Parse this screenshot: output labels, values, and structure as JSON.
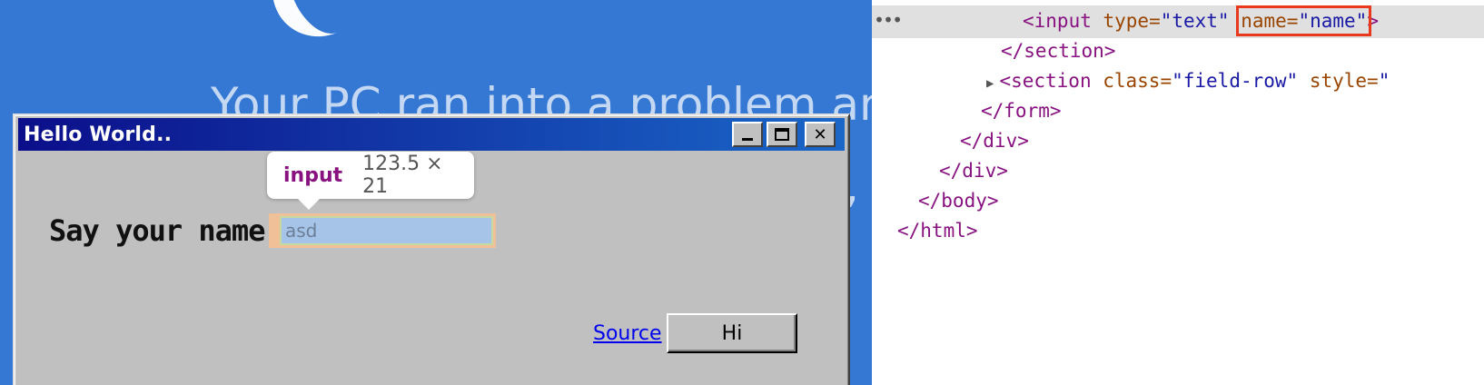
{
  "background": {
    "line1": "Your PC ran into a problem and r",
    "line2": ", ar"
  },
  "window": {
    "title": "Hello World..",
    "controls": {
      "minimize": "_",
      "maximize": "□",
      "close": "✕"
    },
    "label": "Say your name!",
    "input_value": "asd",
    "source_link": "Source",
    "button_label": "Hi"
  },
  "tooltip": {
    "tag": "input",
    "dimensions": "123.5 × 21"
  },
  "devtools": {
    "more_icon": "•••",
    "lines": {
      "l1_tag_open": "<input",
      "l1_type_attr": " type=",
      "l1_type_val": "\"text\"",
      "l1_name_attr": "name=",
      "l1_name_val": "\"name\"",
      "l1_close": ">",
      "l2": "</section>",
      "l3_tag": "<section",
      "l3_class_attr": " class=",
      "l3_class_val": "\"field-row\"",
      "l3_style_attr": " style=",
      "l3_style_val": "\"",
      "l4": "</form>",
      "l5": "</div>",
      "l6": "</div>",
      "l7": "</body>",
      "l8": "</html>"
    }
  },
  "colors": {
    "bsod": "#3578d4",
    "titlebar_start": "#0b0e8a",
    "titlebar_end": "#1a67c8",
    "window_face": "#c0c0c0",
    "highlight_box": "#e8391c",
    "tag_color": "#881280",
    "attr_color": "#994500",
    "value_color": "#1a1aa6"
  }
}
